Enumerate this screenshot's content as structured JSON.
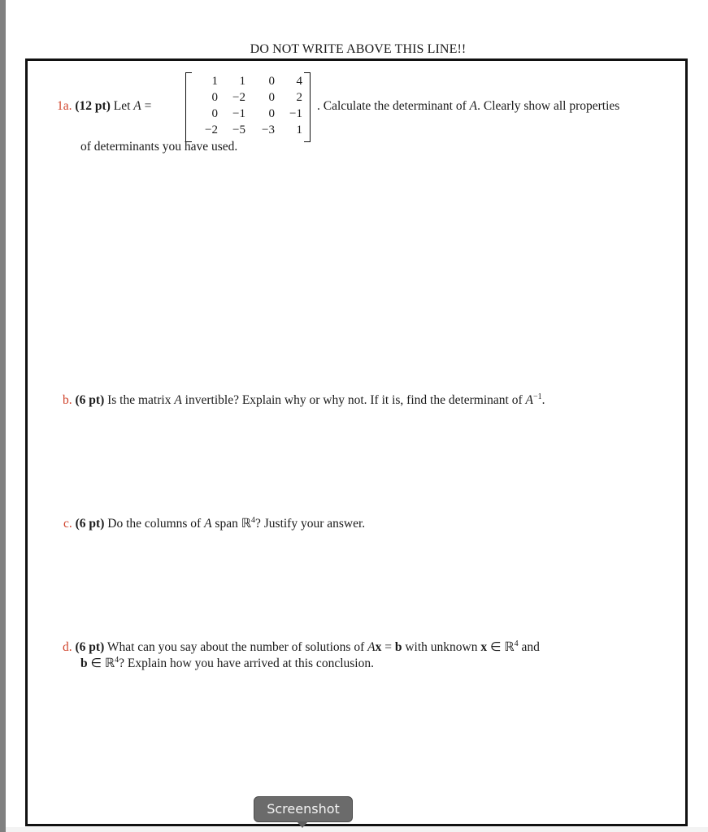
{
  "header": {
    "notice": "DO NOT WRITE ABOVE THIS LINE!!"
  },
  "questions": {
    "a": {
      "number": "1a.",
      "points": "(12 pt)",
      "lead": "Let",
      "var": "A",
      "equals": " =",
      "after_matrix": ". Calculate the determinant of",
      "after_var": "A",
      "after_rest": ".  Clearly show all properties",
      "line2": "of determinants you have used.",
      "matrix": [
        [
          "1",
          "1",
          "0",
          "4"
        ],
        [
          "0",
          "−2",
          "0",
          "2"
        ],
        [
          "0",
          "−1",
          "0",
          "−1"
        ],
        [
          "−2",
          "−5",
          "−3",
          "1"
        ]
      ]
    },
    "b": {
      "number": "b.",
      "points": "(6 pt)",
      "text1": "Is the matrix",
      "var": "A",
      "text2": "invertible? Explain why or why not. If it is, find the determinant of",
      "var2": "A",
      "sup": "−1",
      "end": "."
    },
    "c": {
      "number": "c.",
      "points": "(6 pt)",
      "text1": "Do the columns of",
      "var": "A",
      "text2": "span",
      "space": "ℝ",
      "sup": "4",
      "text3": "?  Justify your answer."
    },
    "d": {
      "number": "d.",
      "points": "(6 pt)",
      "text1": "What can you say about the number of solutions of",
      "eq_A": "A",
      "eq_x": "x",
      "eq_mid": " = ",
      "eq_b": "b",
      "text2": "with unknown",
      "x": "x",
      "in": " ∈ ",
      "space": "ℝ",
      "sup": "4",
      "text3": "and",
      "line2_b": "b",
      "line2_in": " ∈ ",
      "line2_space": "ℝ",
      "line2_sup": "4",
      "line2_rest": "?  Explain how you have arrived at this conclusion."
    }
  },
  "tooltip": {
    "label": "Screenshot"
  },
  "colors": {
    "question_number": "#d0432b",
    "frame": "#111111",
    "tooltip_bg": "#6b6b6b",
    "side_strip": "#808080"
  }
}
